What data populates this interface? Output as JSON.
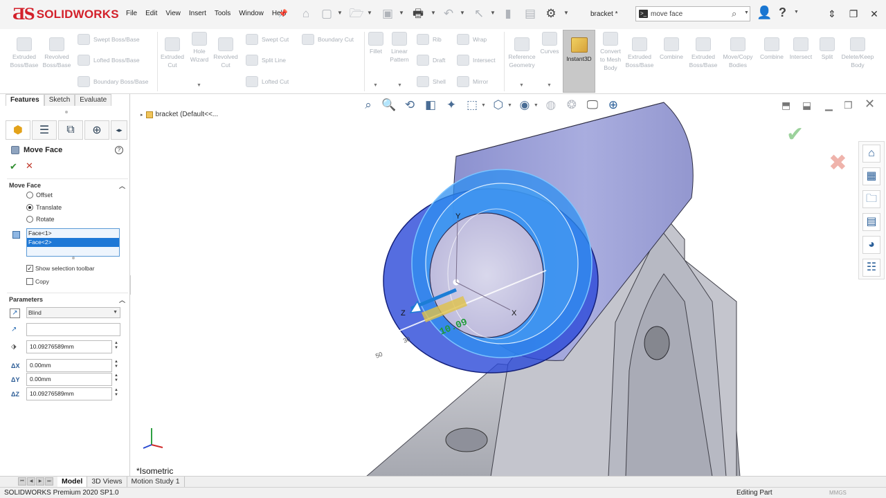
{
  "app": {
    "brand": "SOLIDWORKS",
    "doc_title": "bracket *"
  },
  "menu": [
    "File",
    "Edit",
    "View",
    "Insert",
    "Tools",
    "Window",
    "Help"
  ],
  "search": {
    "value": "move face"
  },
  "commands": {
    "extruded_boss": "Extruded Boss/Base",
    "revolved_boss": "Revolved Boss/Base",
    "swept_boss": "Swept Boss/Base",
    "lofted_boss": "Lofted Boss/Base",
    "boundary_boss": "Boundary Boss/Base",
    "extruded_cut": "Extruded Cut",
    "hole_wizard": "Hole Wizard",
    "revolved_cut": "Revolved Cut",
    "swept_cut": "Swept Cut",
    "lofted_cut": "Lofted Cut",
    "boundary_cut": "Boundary Cut",
    "split_line": "Split Line",
    "fillet": "Fillet",
    "linear_pattern": "Linear Pattern",
    "rib": "Rib",
    "wrap": "Wrap",
    "draft": "Draft",
    "intersect": "Intersect",
    "shell": "Shell",
    "mirror": "Mirror",
    "reference_geometry": "Reference Geometry",
    "curves": "Curves",
    "instant3d": "Instant3D",
    "convert_mesh": "Convert to Mesh Body",
    "extruded_boss2": "Extruded Boss/Base",
    "combine": "Combine",
    "extruded_boss3": "Extruded Boss/Base",
    "move_copy": "Move/Copy Bodies",
    "combine2": "Combine",
    "intersect2": "Intersect",
    "split": "Split",
    "delete_keep": "Delete/Keep Body"
  },
  "manager_tabs": [
    "Features",
    "Sketch",
    "Evaluate"
  ],
  "property_manager": {
    "title": "Move Face",
    "section_move_face": "Move Face",
    "opt_offset": "Offset",
    "opt_translate": "Translate",
    "opt_rotate": "Rotate",
    "faces": [
      "Face<1>",
      "Face<2>"
    ],
    "show_toolbar": "Show selection toolbar",
    "copy": "Copy",
    "section_parameters": "Parameters",
    "end_condition": "Blind",
    "distance": "10.09276589mm",
    "dx": "0.00mm",
    "dy": "0.00mm",
    "dz": "10.09276589mm",
    "dx_label": "ΔX",
    "dy_label": "ΔY",
    "dz_label": "ΔZ"
  },
  "graphics": {
    "tree_flyout": "bracket  (Default<<...",
    "view_label": "*Isometric",
    "ruler_value": "10.09",
    "axis_x": "X",
    "axis_y": "Y",
    "axis_z": "Z"
  },
  "bottom_tabs": [
    "Model",
    "3D Views",
    "Motion Study 1"
  ],
  "status": {
    "product": "SOLIDWORKS Premium 2020 SP1.0",
    "mode": "Editing Part",
    "units": "MMGS"
  },
  "colors": {
    "brand_red": "#d3202a",
    "selection_blue": "#1e78d6",
    "model_lavender": "#a6aade"
  }
}
